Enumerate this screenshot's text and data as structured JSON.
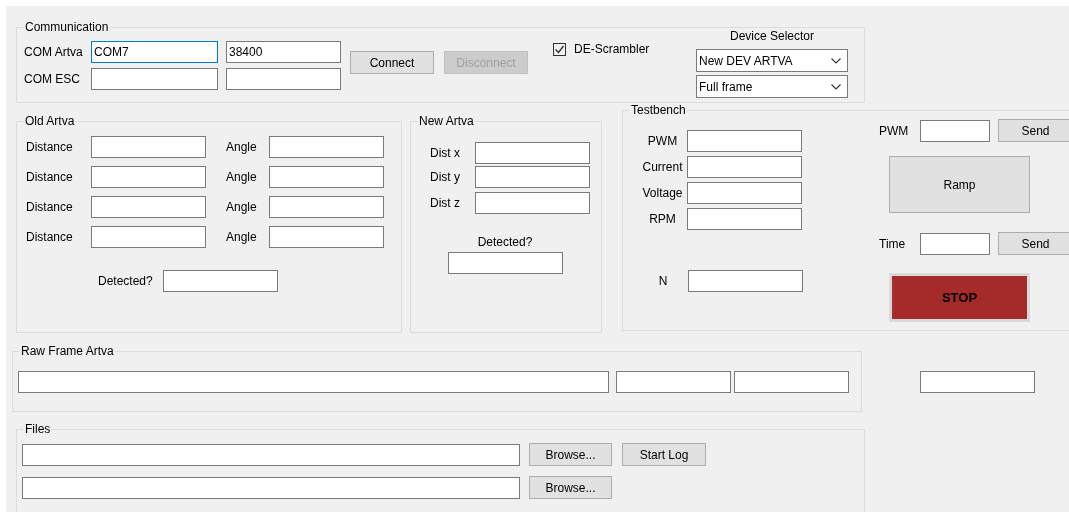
{
  "communication": {
    "title": "Communication",
    "ports": [
      {
        "label": "COM Artva",
        "port": "COM7",
        "baud": "38400",
        "focused": true
      },
      {
        "label": "COM ESC",
        "focused": false
      }
    ],
    "buttons": [
      {
        "label": "Connect",
        "disabled": false
      },
      {
        "label": "Disconnect",
        "disabled": true
      }
    ],
    "de_scrambler": {
      "label": "DE-Scrambler",
      "checked": true
    },
    "device_selector": {
      "title": "Device Selector",
      "dropdowns": [
        {
          "value": "New DEV ARTVA"
        },
        {
          "value": "Full frame"
        }
      ]
    }
  },
  "old_artva": {
    "title": "Old Artva",
    "rows": [
      {
        "distance_label": "Distance",
        "angle_label": "Angle"
      },
      {
        "distance_label": "Distance",
        "angle_label": "Angle"
      },
      {
        "distance_label": "Distance",
        "angle_label": "Angle"
      },
      {
        "distance_label": "Distance",
        "angle_label": "Angle"
      }
    ],
    "detected_label": "Detected?"
  },
  "new_artva": {
    "title": "New Artva",
    "fields": [
      {
        "label": "Dist x"
      },
      {
        "label": "Dist y"
      },
      {
        "label": "Dist z"
      }
    ],
    "detected_label": "Detected?"
  },
  "testbench": {
    "title": "Testbench",
    "readings": [
      {
        "label": "PWM"
      },
      {
        "label": "Current"
      },
      {
        "label": "Voltage"
      },
      {
        "label": "RPM"
      }
    ],
    "n_label": "N",
    "controls": [
      {
        "label": "PWM",
        "button": "Send"
      },
      {
        "label": "Time",
        "button": "Send"
      }
    ],
    "ramp_button": "Ramp",
    "stop_button": "STOP"
  },
  "raw_frame_artva": {
    "title": "Raw Frame Artva"
  },
  "files": {
    "title": "Files",
    "rows": [
      {
        "browse_button": "Browse...",
        "extra_button": "Start Log"
      },
      {
        "browse_button": "Browse..."
      }
    ]
  }
}
